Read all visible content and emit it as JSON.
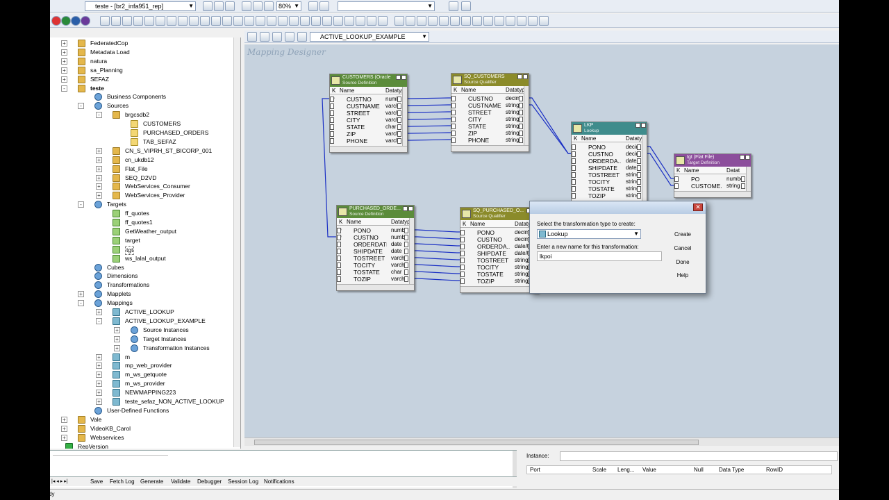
{
  "toolbar": {
    "repo_combo": "teste - [br2_infa951_rep]",
    "zoom": "80%",
    "mapping_combo": "ACTIVE_LOOKUP_EXAMPLE"
  },
  "workspace": {
    "label": "Mapping Designer"
  },
  "tree": [
    {
      "label": "FederatedCop",
      "level": 0,
      "exp": "+",
      "icon": "folder"
    },
    {
      "label": "Metadata Load",
      "level": 0,
      "exp": "+",
      "icon": "folder"
    },
    {
      "label": "natura",
      "level": 0,
      "exp": "+",
      "icon": "folder"
    },
    {
      "label": "sa_Planning",
      "level": 0,
      "exp": "+",
      "icon": "folder"
    },
    {
      "label": "SEFAZ",
      "level": 0,
      "exp": "+",
      "icon": "folder"
    },
    {
      "label": "teste",
      "level": 0,
      "exp": "-",
      "icon": "folder",
      "bold": true
    },
    {
      "label": "Business Components",
      "level": 1,
      "exp": "",
      "icon": "repo"
    },
    {
      "label": "Sources",
      "level": 1,
      "exp": "-",
      "icon": "repo"
    },
    {
      "label": "brgcsdb2",
      "level": 2,
      "exp": "-",
      "icon": "folder"
    },
    {
      "label": "CUSTOMERS",
      "level": 3,
      "exp": "",
      "icon": "src"
    },
    {
      "label": "PURCHASED_ORDERS",
      "level": 3,
      "exp": "",
      "icon": "src"
    },
    {
      "label": "TAB_SEFAZ",
      "level": 3,
      "exp": "",
      "icon": "src"
    },
    {
      "label": "CN_S_VIPRH_ST_BICORP_001",
      "level": 2,
      "exp": "+",
      "icon": "folder"
    },
    {
      "label": "cn_ukdb12",
      "level": 2,
      "exp": "+",
      "icon": "folder"
    },
    {
      "label": "Flat_File",
      "level": 2,
      "exp": "+",
      "icon": "folder"
    },
    {
      "label": "SEQ_D2VD",
      "level": 2,
      "exp": "+",
      "icon": "folder"
    },
    {
      "label": "WebServices_Consumer",
      "level": 2,
      "exp": "+",
      "icon": "folder"
    },
    {
      "label": "WebServices_Provider",
      "level": 2,
      "exp": "+",
      "icon": "folder"
    },
    {
      "label": "Targets",
      "level": 1,
      "exp": "-",
      "icon": "repo"
    },
    {
      "label": "ff_quotes",
      "level": 2,
      "exp": "",
      "icon": "tgt"
    },
    {
      "label": "ff_quotes1",
      "level": 2,
      "exp": "",
      "icon": "tgt"
    },
    {
      "label": "GetWeather_output",
      "level": 2,
      "exp": "",
      "icon": "tgt"
    },
    {
      "label": "target",
      "level": 2,
      "exp": "",
      "icon": "tgt"
    },
    {
      "label": "tgt",
      "level": 2,
      "exp": "",
      "icon": "tgt",
      "selected": true
    },
    {
      "label": "ws_lalal_output",
      "level": 2,
      "exp": "",
      "icon": "tgt"
    },
    {
      "label": "Cubes",
      "level": 1,
      "exp": "",
      "icon": "repo"
    },
    {
      "label": "Dimensions",
      "level": 1,
      "exp": "",
      "icon": "repo"
    },
    {
      "label": "Transformations",
      "level": 1,
      "exp": "",
      "icon": "repo"
    },
    {
      "label": "Mapplets",
      "level": 1,
      "exp": "+",
      "icon": "repo"
    },
    {
      "label": "Mappings",
      "level": 1,
      "exp": "-",
      "icon": "repo"
    },
    {
      "label": "ACTIVE_LOOKUP",
      "level": 2,
      "exp": "+",
      "icon": "map"
    },
    {
      "label": "ACTIVE_LOOKUP_EXAMPLE",
      "level": 2,
      "exp": "-",
      "icon": "map"
    },
    {
      "label": "Source Instances",
      "level": 3,
      "exp": "+",
      "icon": "repo"
    },
    {
      "label": "Target Instances",
      "level": 3,
      "exp": "+",
      "icon": "repo"
    },
    {
      "label": "Transformation Instances",
      "level": 3,
      "exp": "+",
      "icon": "repo"
    },
    {
      "label": "m",
      "level": 2,
      "exp": "+",
      "icon": "map"
    },
    {
      "label": "mp_web_provider",
      "level": 2,
      "exp": "+",
      "icon": "map"
    },
    {
      "label": "m_ws_getquote",
      "level": 2,
      "exp": "+",
      "icon": "map"
    },
    {
      "label": "m_ws_provider",
      "level": 2,
      "exp": "+",
      "icon": "map"
    },
    {
      "label": "NEWMAPPING223",
      "level": 2,
      "exp": "+",
      "icon": "map"
    },
    {
      "label": "teste_sefaz_NON_ACTIVE_LOOKUP",
      "level": 2,
      "exp": "+",
      "icon": "map"
    },
    {
      "label": "User-Defined Functions",
      "level": 1,
      "exp": "",
      "icon": "repo"
    },
    {
      "label": "Vale",
      "level": 0,
      "exp": "+",
      "icon": "folder"
    },
    {
      "label": "VideoKB_Carol",
      "level": 0,
      "exp": "+",
      "icon": "folder"
    },
    {
      "label": "Webservices",
      "level": 0,
      "exp": "+",
      "icon": "folder"
    },
    {
      "label": "RepVersion",
      "level": -1,
      "exp": "",
      "icon": "green"
    }
  ],
  "transformations": [
    {
      "id": "customers",
      "title": "CUSTOMERS (Oracle",
      "subtitle": "Source Definition",
      "color": "#5b8c3a",
      "col_name": "Name",
      "col_type": "Datatype",
      "ports": [
        [
          "CUSTNO",
          "numbe"
        ],
        [
          "CUSTNAME",
          "varch"
        ],
        [
          "STREET",
          "varch"
        ],
        [
          "CITY",
          "varch"
        ],
        [
          "STATE",
          "char"
        ],
        [
          "ZIP",
          "varch"
        ],
        [
          "PHONE",
          "varch"
        ]
      ],
      "key": [
        0
      ]
    },
    {
      "id": "sq_customers",
      "title": "SQ_CUSTOMERS",
      "subtitle": "Source Qualifier",
      "color": "#8b8b2a",
      "col_name": "Name",
      "col_type": "Datatype",
      "ports": [
        [
          "CUSTNO",
          "decimal"
        ],
        [
          "CUSTNAME",
          "string"
        ],
        [
          "STREET",
          "string"
        ],
        [
          "CITY",
          "string"
        ],
        [
          "STATE",
          "string"
        ],
        [
          "ZIP",
          "string"
        ],
        [
          "PHONE",
          "string"
        ]
      ],
      "key": []
    },
    {
      "id": "lkp",
      "title": "LKP",
      "subtitle": "Lookup",
      "color": "#3f8c8c",
      "col_name": "Name",
      "col_type": "Datatype",
      "ports": [
        [
          "PONO",
          "decimal"
        ],
        [
          "CUSTNO",
          "decimal"
        ],
        [
          "ORDERDA...",
          "date/time"
        ],
        [
          "SHIPDATE",
          "date/time"
        ],
        [
          "TOSTREET",
          "string"
        ],
        [
          "TOCITY",
          "string"
        ],
        [
          "TOSTATE",
          "string"
        ],
        [
          "TOZIP",
          "string"
        ]
      ],
      "key": []
    },
    {
      "id": "flatfile",
      "title": "tgt (Flat File)",
      "subtitle": "Target Definition",
      "color": "#8c4e9c",
      "col_name": "Name",
      "col_type": "Datat",
      "ports": [
        [
          "PO",
          "numbe"
        ],
        [
          "CUSTOME...",
          "string"
        ]
      ],
      "key": []
    },
    {
      "id": "purchased",
      "title": "PURCHASED_ORDE...",
      "subtitle": "Source Definition",
      "color": "#5b8c3a",
      "col_name": "Name",
      "col_type": "Datatype",
      "ports": [
        [
          "PONO",
          "numbe"
        ],
        [
          "CUSTNO",
          "numbe"
        ],
        [
          "ORDERDATE",
          "date"
        ],
        [
          "SHIPDATE",
          "date"
        ],
        [
          "TOSTREET",
          "varch"
        ],
        [
          "TOCITY",
          "varch"
        ],
        [
          "TOSTATE",
          "char"
        ],
        [
          "TOZIP",
          "varch"
        ]
      ],
      "key": [
        0,
        1
      ]
    },
    {
      "id": "sq_purchased",
      "title": "SQ_PURCHASED_O...",
      "subtitle": "Source Qualifier",
      "color": "#8b8b2a",
      "col_name": "Name",
      "col_type": "Datatype",
      "ports": [
        [
          "PONO",
          "decimal"
        ],
        [
          "CUSTNO",
          "decimal"
        ],
        [
          "ORDERDA...",
          "date/time"
        ],
        [
          "SHIPDATE",
          "date/time"
        ],
        [
          "TOSTREET",
          "string"
        ],
        [
          "TOCITY",
          "string"
        ],
        [
          "TOSTATE",
          "string"
        ],
        [
          "TOZIP",
          "string"
        ]
      ],
      "key": []
    }
  ],
  "dialog": {
    "type_label": "Select the transformation type to create:",
    "type_value": "Lookup",
    "name_label": "Enter a new name for this transformation:",
    "name_value": "lkpoi",
    "create": "Create",
    "cancel": "Cancel",
    "done": "Done",
    "help": "Help"
  },
  "bottom_tabs": [
    "Save",
    "Fetch Log",
    "Generate",
    "Validate",
    "Debugger",
    "Session Log",
    "Notifications"
  ],
  "properties": {
    "instance_label": "Instance:",
    "columns": [
      "Port",
      "Scale",
      "Leng...",
      "Value",
      "Null",
      "Data Type",
      "RowID"
    ]
  },
  "status": "dy"
}
